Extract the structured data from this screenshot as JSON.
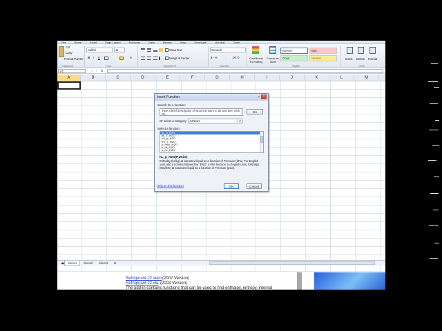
{
  "ribbon": {
    "tabs": [
      "File",
      "Home",
      "Insert",
      "Page Layout",
      "Formulas",
      "Data",
      "Review",
      "View",
      "Developer",
      "Acrobat",
      "Team"
    ],
    "clipboard": {
      "cut": "Cut",
      "copy": "Copy",
      "format_painter": "Format Painter",
      "group": "Clipboard"
    },
    "font": {
      "name": "Calibri",
      "size": "11",
      "group": "Font"
    },
    "alignment": {
      "wrap_text": "Wrap Text",
      "merge_center": "Merge & Center",
      "group": "Alignment"
    },
    "number": {
      "format": "General",
      "group": "Number"
    },
    "styles": {
      "conditional_formatting": "Conditional Formatting",
      "format_as_table": "Format as Table",
      "normal": "Normal",
      "bad": "Bad",
      "good": "Good",
      "neutral": "Neutral",
      "group": "Styles"
    },
    "cells": {
      "insert": "Insert",
      "delete": "Delete",
      "format": "Format",
      "group": "Cells"
    }
  },
  "formula_bar": {
    "name_box": "A1",
    "fx": "fx"
  },
  "columns": [
    "A",
    "B",
    "C",
    "D",
    "E",
    "F",
    "G",
    "H",
    "I",
    "J",
    "K",
    "L",
    "M"
  ],
  "sheets": [
    "Sheet1",
    "Sheet2",
    "Sheet3"
  ],
  "dialog": {
    "title": "Insert Function",
    "help_glyph": "?",
    "close_glyph": "×",
    "search_label": "Search for a function:",
    "search_value": "Type a brief description of what you want to do and then click Go",
    "go_label": "Go",
    "category_label": "Or select a category:",
    "category_value": "XSteam",
    "category_arrow": "▼",
    "select_label": "Select a function:",
    "functions": [
      "hL_p_H2O",
      "hL_T_H2O",
      "hV_p_H2O",
      "hV_T_H2O",
      "p_hrho_H2O",
      "p_hs_H2O",
      "p_hv_H2O"
    ],
    "selected_index": 0,
    "signature": "hL_p_H2O(P,Units)",
    "description": "Enthalpy (kJ/kg) at saturated liquid as a function of Pressure (kPa). For English units add a comma followed by \"ENG\" to the function. In English units, Enthalpy (Btu/lbm) at saturated liquid as a function of Pressure (psia).",
    "help_link": "Help on this function",
    "ok_label": "OK",
    "cancel_label": "Cancel"
  },
  "doc": {
    "link1": "Refrigerant 22.xlam",
    "link1_suffix": "(2007 Version)",
    "link2": "Refrigerant 22.xla",
    "link2_suffix": "(2003 Version)",
    "line3": "The add-in contains functions that can be used to find enthalpy, entropy, internal"
  },
  "colors": {
    "accent": "#3b82d6",
    "selection": "#3b82d6",
    "link": "#2440c8"
  }
}
